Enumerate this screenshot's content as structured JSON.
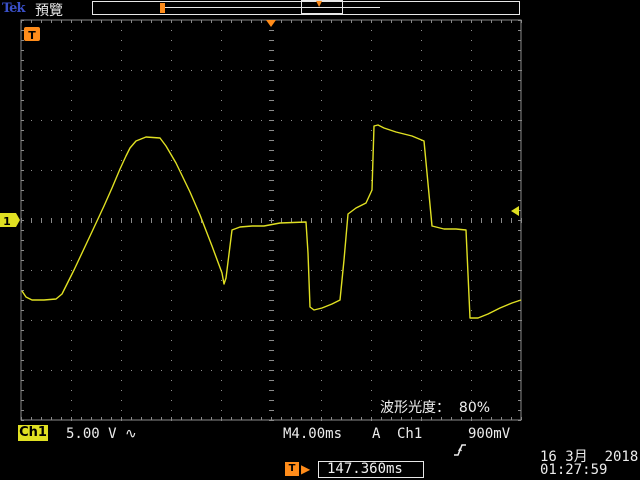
{
  "header": {
    "brand": "Tek",
    "mode": "預覽"
  },
  "screen": {
    "trigger_marker_label": "T",
    "channel_marker_label": "1",
    "trace_color": "#e0e022",
    "trigger_color": "#ff8c1a",
    "grid_color": "#8a8a8a"
  },
  "measurement": {
    "label": "波形光度：",
    "value": "80%"
  },
  "status": {
    "channel": "Ch1",
    "channel_scale": "5.00 V",
    "coupling_icon": "ac-coupling-icon",
    "timebase": "M4.00ms",
    "trigger_mode": "A",
    "trigger_source": "Ch1",
    "trigger_slope_icon": "rising-edge-icon",
    "trigger_level": "900mV",
    "trigger_position_label": "T",
    "trigger_position": "147.360ms",
    "date": "16 3月  2018",
    "time": "01:27:59"
  }
}
